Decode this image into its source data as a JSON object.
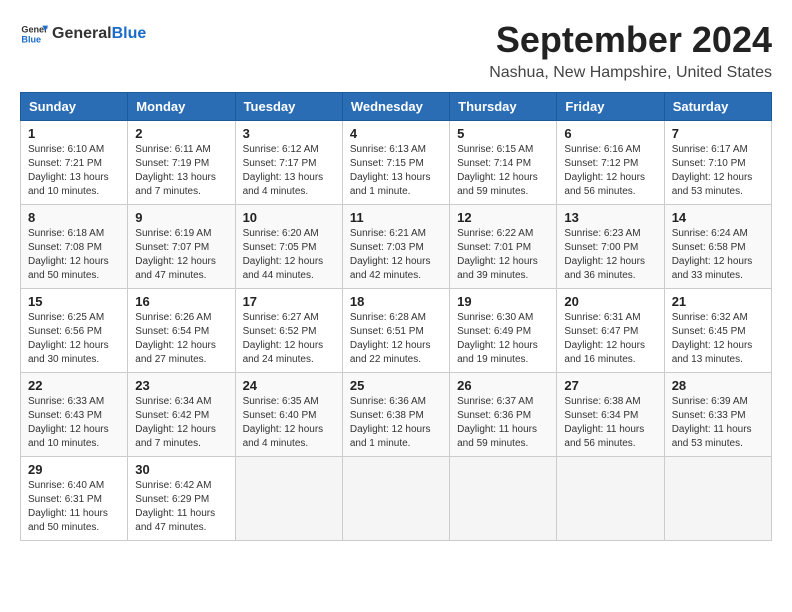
{
  "logo": {
    "general": "General",
    "blue": "Blue"
  },
  "title": "September 2024",
  "location": "Nashua, New Hampshire, United States",
  "days_of_week": [
    "Sunday",
    "Monday",
    "Tuesday",
    "Wednesday",
    "Thursday",
    "Friday",
    "Saturday"
  ],
  "weeks": [
    [
      {
        "day": "1",
        "info": "Sunrise: 6:10 AM\nSunset: 7:21 PM\nDaylight: 13 hours\nand 10 minutes."
      },
      {
        "day": "2",
        "info": "Sunrise: 6:11 AM\nSunset: 7:19 PM\nDaylight: 13 hours\nand 7 minutes."
      },
      {
        "day": "3",
        "info": "Sunrise: 6:12 AM\nSunset: 7:17 PM\nDaylight: 13 hours\nand 4 minutes."
      },
      {
        "day": "4",
        "info": "Sunrise: 6:13 AM\nSunset: 7:15 PM\nDaylight: 13 hours\nand 1 minute."
      },
      {
        "day": "5",
        "info": "Sunrise: 6:15 AM\nSunset: 7:14 PM\nDaylight: 12 hours\nand 59 minutes."
      },
      {
        "day": "6",
        "info": "Sunrise: 6:16 AM\nSunset: 7:12 PM\nDaylight: 12 hours\nand 56 minutes."
      },
      {
        "day": "7",
        "info": "Sunrise: 6:17 AM\nSunset: 7:10 PM\nDaylight: 12 hours\nand 53 minutes."
      }
    ],
    [
      {
        "day": "8",
        "info": "Sunrise: 6:18 AM\nSunset: 7:08 PM\nDaylight: 12 hours\nand 50 minutes."
      },
      {
        "day": "9",
        "info": "Sunrise: 6:19 AM\nSunset: 7:07 PM\nDaylight: 12 hours\nand 47 minutes."
      },
      {
        "day": "10",
        "info": "Sunrise: 6:20 AM\nSunset: 7:05 PM\nDaylight: 12 hours\nand 44 minutes."
      },
      {
        "day": "11",
        "info": "Sunrise: 6:21 AM\nSunset: 7:03 PM\nDaylight: 12 hours\nand 42 minutes."
      },
      {
        "day": "12",
        "info": "Sunrise: 6:22 AM\nSunset: 7:01 PM\nDaylight: 12 hours\nand 39 minutes."
      },
      {
        "day": "13",
        "info": "Sunrise: 6:23 AM\nSunset: 7:00 PM\nDaylight: 12 hours\nand 36 minutes."
      },
      {
        "day": "14",
        "info": "Sunrise: 6:24 AM\nSunset: 6:58 PM\nDaylight: 12 hours\nand 33 minutes."
      }
    ],
    [
      {
        "day": "15",
        "info": "Sunrise: 6:25 AM\nSunset: 6:56 PM\nDaylight: 12 hours\nand 30 minutes."
      },
      {
        "day": "16",
        "info": "Sunrise: 6:26 AM\nSunset: 6:54 PM\nDaylight: 12 hours\nand 27 minutes."
      },
      {
        "day": "17",
        "info": "Sunrise: 6:27 AM\nSunset: 6:52 PM\nDaylight: 12 hours\nand 24 minutes."
      },
      {
        "day": "18",
        "info": "Sunrise: 6:28 AM\nSunset: 6:51 PM\nDaylight: 12 hours\nand 22 minutes."
      },
      {
        "day": "19",
        "info": "Sunrise: 6:30 AM\nSunset: 6:49 PM\nDaylight: 12 hours\nand 19 minutes."
      },
      {
        "day": "20",
        "info": "Sunrise: 6:31 AM\nSunset: 6:47 PM\nDaylight: 12 hours\nand 16 minutes."
      },
      {
        "day": "21",
        "info": "Sunrise: 6:32 AM\nSunset: 6:45 PM\nDaylight: 12 hours\nand 13 minutes."
      }
    ],
    [
      {
        "day": "22",
        "info": "Sunrise: 6:33 AM\nSunset: 6:43 PM\nDaylight: 12 hours\nand 10 minutes."
      },
      {
        "day": "23",
        "info": "Sunrise: 6:34 AM\nSunset: 6:42 PM\nDaylight: 12 hours\nand 7 minutes."
      },
      {
        "day": "24",
        "info": "Sunrise: 6:35 AM\nSunset: 6:40 PM\nDaylight: 12 hours\nand 4 minutes."
      },
      {
        "day": "25",
        "info": "Sunrise: 6:36 AM\nSunset: 6:38 PM\nDaylight: 12 hours\nand 1 minute."
      },
      {
        "day": "26",
        "info": "Sunrise: 6:37 AM\nSunset: 6:36 PM\nDaylight: 11 hours\nand 59 minutes."
      },
      {
        "day": "27",
        "info": "Sunrise: 6:38 AM\nSunset: 6:34 PM\nDaylight: 11 hours\nand 56 minutes."
      },
      {
        "day": "28",
        "info": "Sunrise: 6:39 AM\nSunset: 6:33 PM\nDaylight: 11 hours\nand 53 minutes."
      }
    ],
    [
      {
        "day": "29",
        "info": "Sunrise: 6:40 AM\nSunset: 6:31 PM\nDaylight: 11 hours\nand 50 minutes."
      },
      {
        "day": "30",
        "info": "Sunrise: 6:42 AM\nSunset: 6:29 PM\nDaylight: 11 hours\nand 47 minutes."
      },
      {
        "day": "",
        "info": ""
      },
      {
        "day": "",
        "info": ""
      },
      {
        "day": "",
        "info": ""
      },
      {
        "day": "",
        "info": ""
      },
      {
        "day": "",
        "info": ""
      }
    ]
  ]
}
